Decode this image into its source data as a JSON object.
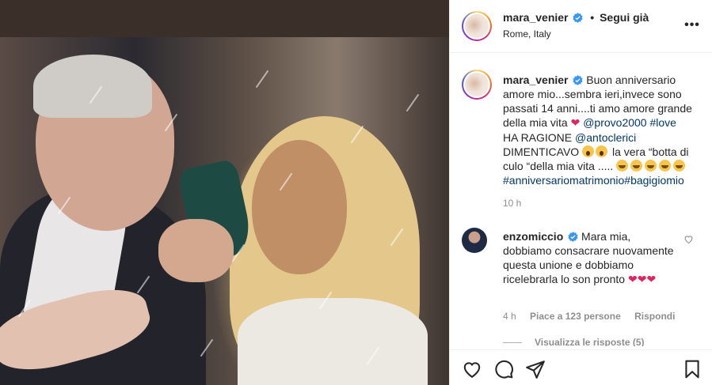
{
  "post": {
    "username": "mara_venier",
    "follow_status": "Segui già",
    "separator": "•",
    "location": "Rome, Italy",
    "more_icon": "more-options-icon"
  },
  "caption": {
    "username": "mara_venier",
    "text_1": "Buon anniversario amore mio...sembra ieri,invece sono passati 14 anni....ti amo amore grande della mia vita",
    "mention_1": "@provo2000",
    "hashtag_1": "#love",
    "text_2": "HA RAGIONE",
    "mention_2": "@antoclerici",
    "text_3": "DIMENTICAVO",
    "text_4": "la vera “botta di culo “della mia vita .....",
    "hashtags_2": "#anniversariomatrimonio#bagigiomio",
    "time": "10 h"
  },
  "comment": {
    "username": "enzomiccio",
    "text": "Mara mia, dobbiamo consacrare nuovamente questa unione e dobbiamo ricelebrarla lo son pronto",
    "time": "4 h",
    "likes": "Piace a 123 persone",
    "reply_label": "Rispondi",
    "view_replies": "Visualizza le risposte (5)"
  },
  "actions": {
    "like_icon": "heart-icon",
    "comment_icon": "comment-icon",
    "share_icon": "share-icon",
    "save_icon": "bookmark-icon"
  },
  "colors": {
    "link": "#00376b",
    "muted": "#8e8e8e",
    "verified": "#3897f0",
    "heart": "#e0245e"
  }
}
